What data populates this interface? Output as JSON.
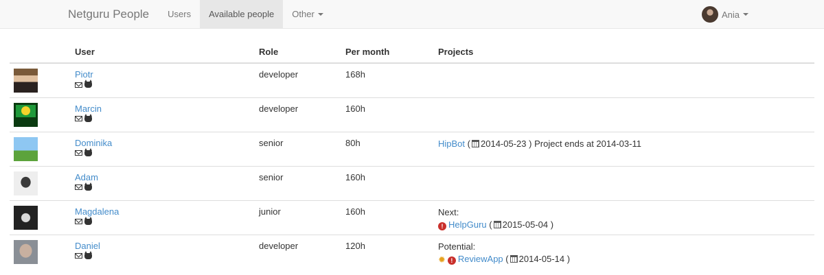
{
  "navbar": {
    "brand": "Netguru People",
    "items": [
      {
        "label": "Users"
      },
      {
        "label": "Available people"
      },
      {
        "label": "Other"
      }
    ],
    "user": "Ania"
  },
  "table": {
    "headers": {
      "user": "User",
      "role": "Role",
      "per_month": "Per month",
      "projects": "Projects"
    },
    "rows": [
      {
        "name": "Piotr",
        "role": "developer",
        "per_month": "168h"
      },
      {
        "name": "Marcin",
        "role": "developer",
        "per_month": "160h"
      },
      {
        "name": "Dominika",
        "role": "senior",
        "per_month": "80h",
        "project": {
          "name": "HipBot",
          "date": "2014-05-23",
          "note": "Project ends at 2014-03-11"
        }
      },
      {
        "name": "Adam",
        "role": "senior",
        "per_month": "160h"
      },
      {
        "name": "Magdalena",
        "role": "junior",
        "per_month": "160h",
        "project": {
          "heading": "Next:",
          "name": "HelpGuru",
          "date": "2015-05-04"
        }
      },
      {
        "name": "Daniel",
        "role": "developer",
        "per_month": "120h",
        "project": {
          "heading": "Potential:",
          "name": "ReviewApp",
          "date": "2014-05-14"
        }
      }
    ]
  },
  "colors": {
    "link": "#428bca",
    "alert": "#c9302c",
    "star": "#e6a21f"
  },
  "icons": [
    "mail-icon",
    "github-icon",
    "calendar-icon",
    "alert-icon",
    "star-icon",
    "caret-down-icon"
  ]
}
